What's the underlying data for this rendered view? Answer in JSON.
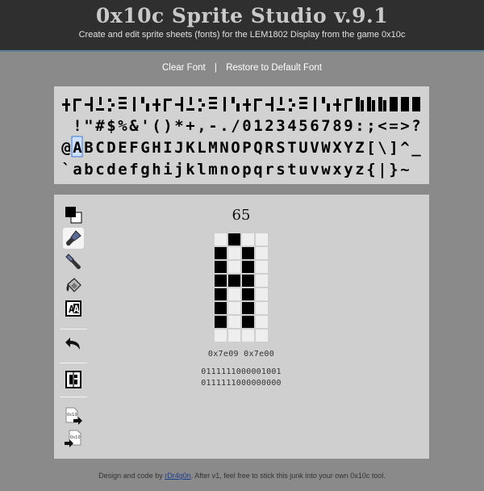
{
  "header": {
    "title": "0x10c Sprite Studio v.9.1",
    "subtitle": "Create and edit sprite sheets (fonts) for the LEM1802 Display from the game 0x10c"
  },
  "links": {
    "clear_font": "Clear Font",
    "separator": "|",
    "restore_font": "Restore to Default Font"
  },
  "font_sheet": {
    "rows": [
      "",
      " !\"#$%&'()*+,-./0123456789:;<=>?",
      "@ABCDEFGHIJKLMNOPQRSTUVWXYZ[\\]^_",
      "`abcdefghijklmnopqrstuvwxyz{|}~"
    ],
    "selected_index": 65
  },
  "tools": [
    {
      "name": "color-swap-icon",
      "active": false
    },
    {
      "name": "paint-brush-icon",
      "active": true
    },
    {
      "name": "erase-brush-icon",
      "active": false
    },
    {
      "name": "fill-bucket-icon",
      "active": false
    },
    {
      "name": "invert-icon",
      "active": false
    },
    {
      "name": "undo-icon",
      "active": false
    },
    {
      "name": "flip-icon",
      "active": false
    },
    {
      "name": "export-icon",
      "active": false
    },
    {
      "name": "import-icon",
      "active": false
    }
  ],
  "editor": {
    "char_code": "65",
    "pixels": [
      [
        0,
        1,
        0,
        0
      ],
      [
        1,
        0,
        1,
        0
      ],
      [
        1,
        0,
        1,
        0
      ],
      [
        1,
        1,
        1,
        0
      ],
      [
        1,
        0,
        1,
        0
      ],
      [
        1,
        0,
        1,
        0
      ],
      [
        1,
        0,
        1,
        0
      ],
      [
        0,
        0,
        0,
        0
      ]
    ],
    "hex": "0x7e09 0x7e00",
    "binary_1": "0111111000001001",
    "binary_2": "0111111000000000"
  },
  "colors": {
    "on": "#000000",
    "off": "#ffffff",
    "editor_off": "#eeeeee",
    "selection": "#3a7bd5"
  },
  "footer": {
    "prefix": "Design and code by ",
    "author": "rDr4g0n",
    "suffix": ". After v1, feel free to stick this junk into your own 0x10c tool."
  }
}
